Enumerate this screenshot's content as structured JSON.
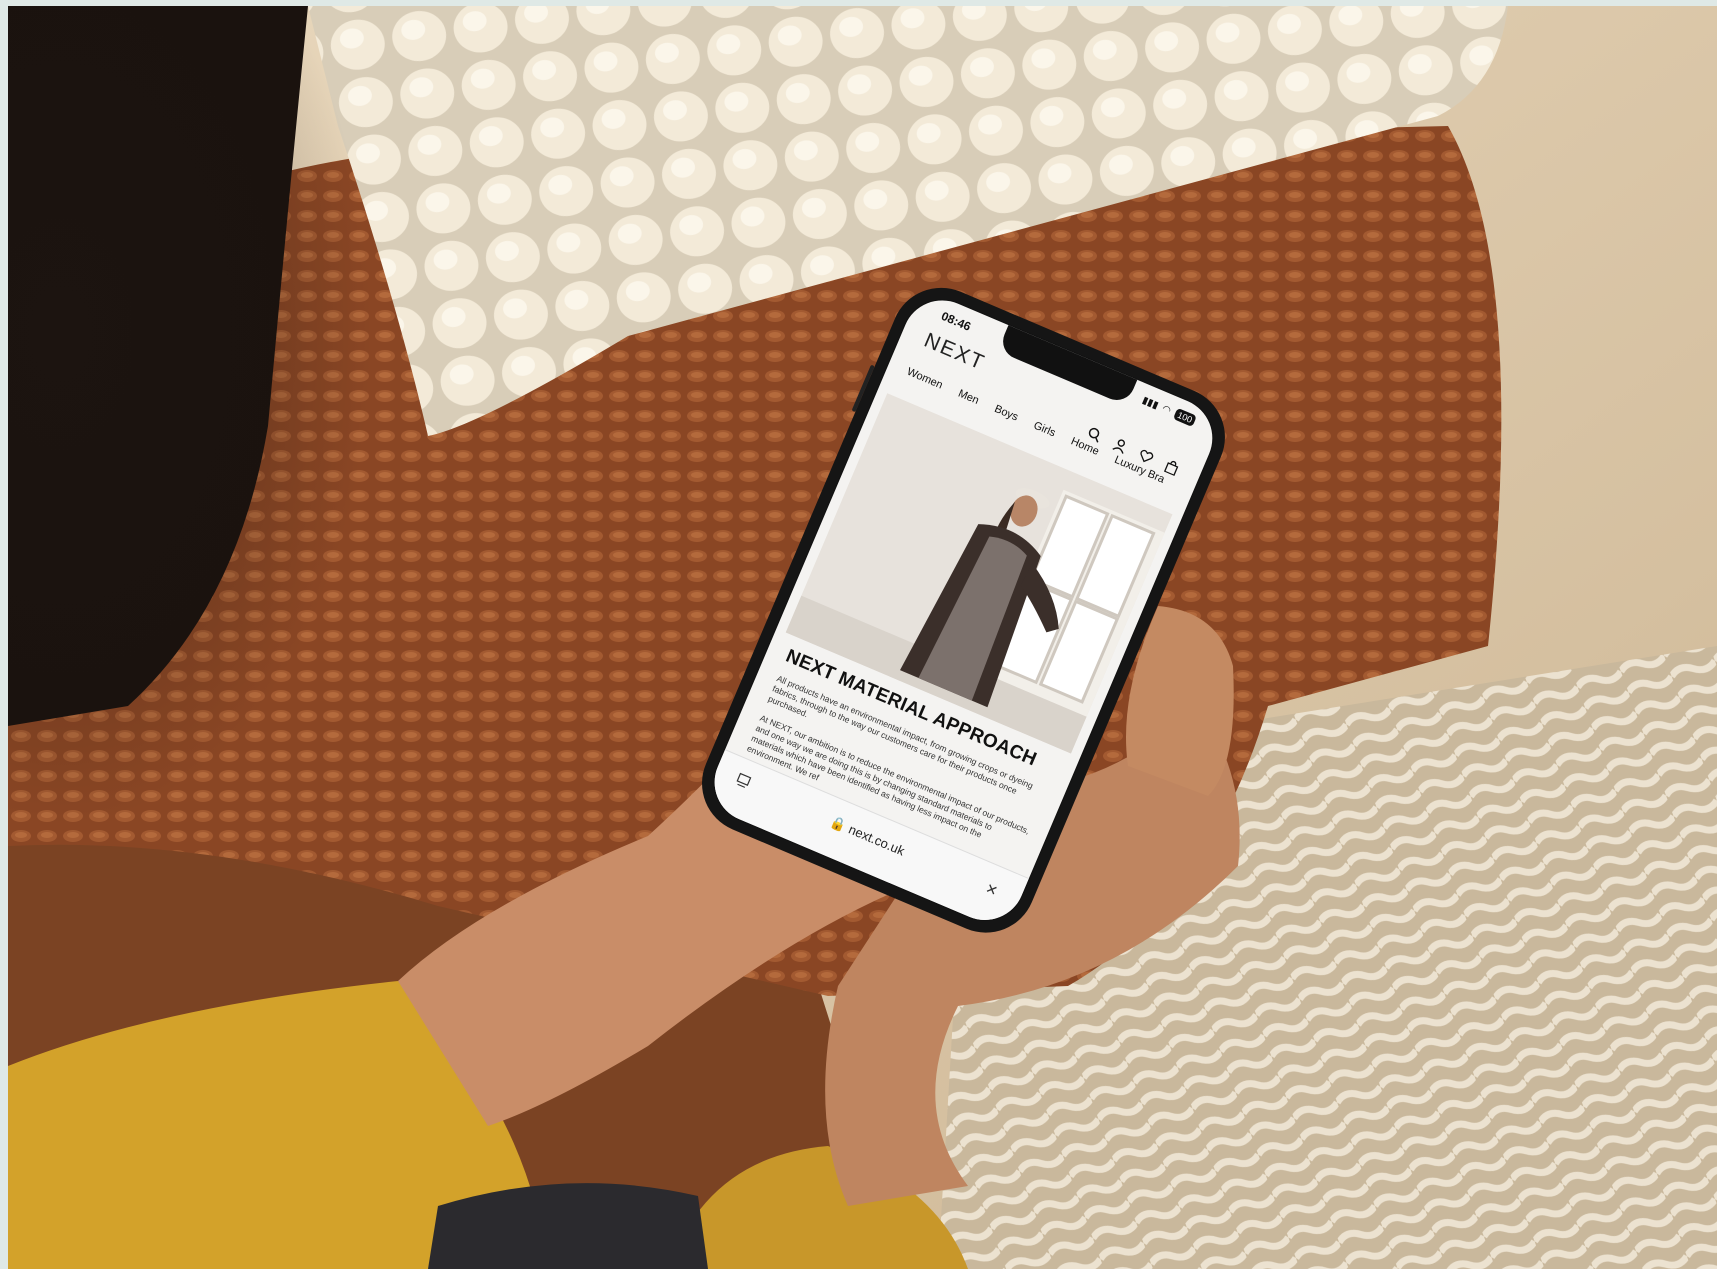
{
  "phone": {
    "status_time": "08:46",
    "battery": "100"
  },
  "site": {
    "brand": "NEXT",
    "nav_items": [
      "Women",
      "Men",
      "Boys",
      "Girls",
      "Home",
      "Luxury Bra"
    ],
    "icons": [
      "search-icon",
      "account-icon",
      "wishlist-icon",
      "bag-icon"
    ]
  },
  "article": {
    "heading": "NEXT MATERIAL APPROACH",
    "paragraph_1": "All products have an environmental impact, from growing crops or dyeing fabrics, through to the way our customers care for their products once purchased.",
    "paragraph_2": "At NEXT, our ambition is to reduce the environmental impact of our products, and one way we are doing this is by changing standard materials to materials which have been identified as having less impact on the environment. We ref"
  },
  "browser": {
    "url": "next.co.uk"
  },
  "colors": {
    "sleeve": "#d4a52c",
    "throw": "#8e4b26",
    "cushion": "#efe6d3",
    "carpet": "#d8cbb5"
  }
}
